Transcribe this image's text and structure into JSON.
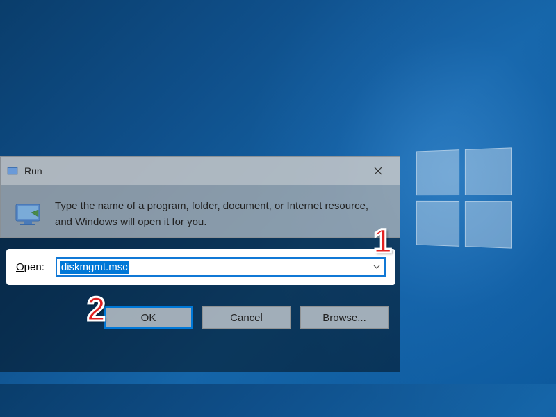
{
  "dialog": {
    "title": "Run",
    "description": "Type the name of a program, folder, document, or Internet resource, and Windows will open it for you.",
    "open_label_prefix": "O",
    "open_label_rest": "pen:",
    "input_value": "diskmgmt.msc",
    "buttons": {
      "ok": "OK",
      "cancel": "Cancel",
      "browse_prefix": "B",
      "browse_rest": "rowse..."
    }
  },
  "annotations": {
    "one": "1",
    "two": "2"
  }
}
